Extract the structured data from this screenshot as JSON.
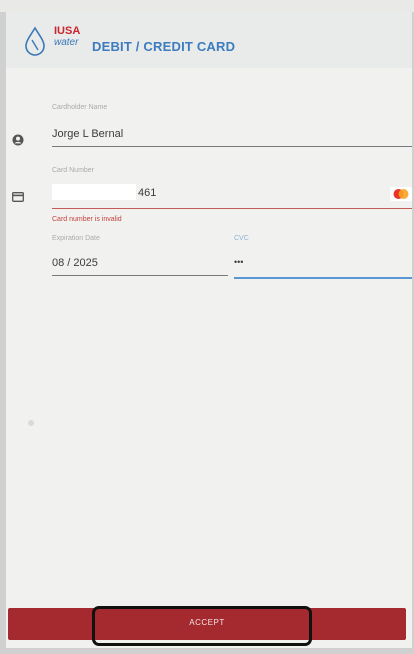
{
  "header": {
    "logo_top": "IUSA",
    "logo_bottom": "water",
    "title": "DEBIT / CREDIT CARD"
  },
  "form": {
    "cardholder": {
      "label": "Cardholder Name",
      "value": "Jorge L Bernal"
    },
    "card_number": {
      "label": "Card Number",
      "value_suffix": "461",
      "error": "Card number is invalid"
    },
    "expiration": {
      "label": "Expiration Date",
      "value": "08 / 2025"
    },
    "cvc": {
      "label": "CVC",
      "value": "•••"
    }
  },
  "footer": {
    "accept_label": "ACCEPT"
  },
  "colors": {
    "accent_blue": "#3d7cc0",
    "accept_red": "#a52a2f",
    "error_red": "#c4403f"
  },
  "icons": {
    "cardholder": "person-icon",
    "card_number": "credit-card-icon",
    "card_brand": "mastercard-icon"
  }
}
